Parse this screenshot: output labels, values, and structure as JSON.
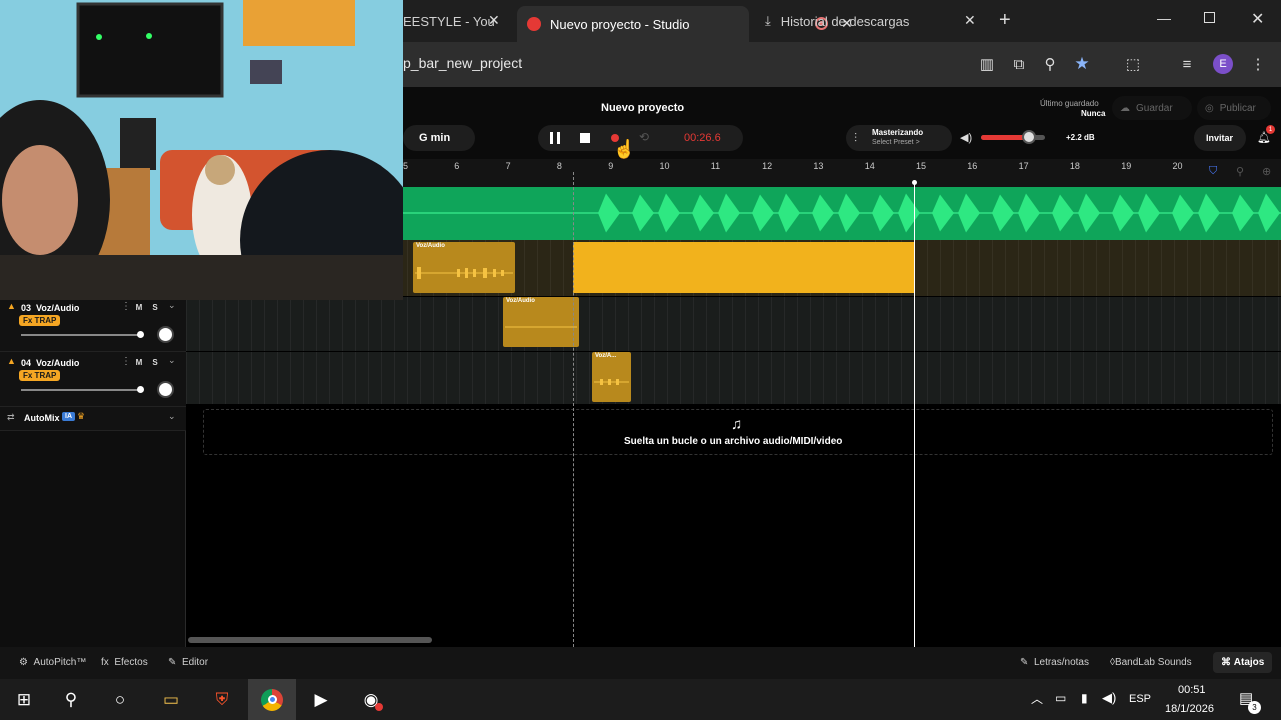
{
  "browser": {
    "tabs": [
      {
        "label": "EESTYLE - You",
        "active": false
      },
      {
        "label": "Nuevo proyecto - Studio",
        "active": true
      },
      {
        "label": "Historial de descargas",
        "active": false
      }
    ],
    "new_tab_label": "+",
    "url": "p_bar_new_project",
    "profile_initial": "E"
  },
  "studio": {
    "project_title": "Nuevo proyecto",
    "last_saved_label": "Último guardado",
    "last_saved_value": "Nunca",
    "save_label": "Guardar",
    "publish_label": "Publicar",
    "key": "G min",
    "time": "00:26.6",
    "mastering_label": "Masterizando",
    "mastering_preset": "Select Preset >",
    "master_gain": "+2.2 dB",
    "master_volume": 0.75,
    "invite_label": "Invitar",
    "notification_count": "1"
  },
  "ruler": {
    "ticks": [
      "5",
      "6",
      "7",
      "8",
      "9",
      "10",
      "11",
      "12",
      "13",
      "14",
      "15",
      "16",
      "17",
      "18",
      "19",
      "20"
    ]
  },
  "tracks": [
    {
      "number": "03",
      "name": "Voz/Audio",
      "fx": "Fx TRAP",
      "mute": "M",
      "solo": "S"
    },
    {
      "number": "04",
      "name": "Voz/Audio",
      "fx": "Fx TRAP",
      "mute": "M",
      "solo": "S"
    }
  ],
  "clips": [
    {
      "label": "Voz/Audio"
    },
    {
      "label": "Voz/Audio"
    },
    {
      "label": "Voz/A..."
    }
  ],
  "automix": {
    "label": "AutoMix",
    "badge": "IA"
  },
  "dropzone": {
    "text": "Suelta un bucle o un archivo audio/MIDI/video"
  },
  "bottom": {
    "autopitch": "AutoPitch™",
    "efectos": "Efectos",
    "editor": "Editor",
    "letras": "Letras/notas",
    "bandlab_sounds": "BandLab Sounds",
    "atajos": "Atajos"
  },
  "taskbar": {
    "lang": "ESP",
    "time": "00:51",
    "date": "18/1/2026",
    "notif_count": "3"
  },
  "colors": {
    "accent_orange": "#f5a623",
    "green_track": "#0fa55a",
    "record_red": "#e53935"
  }
}
